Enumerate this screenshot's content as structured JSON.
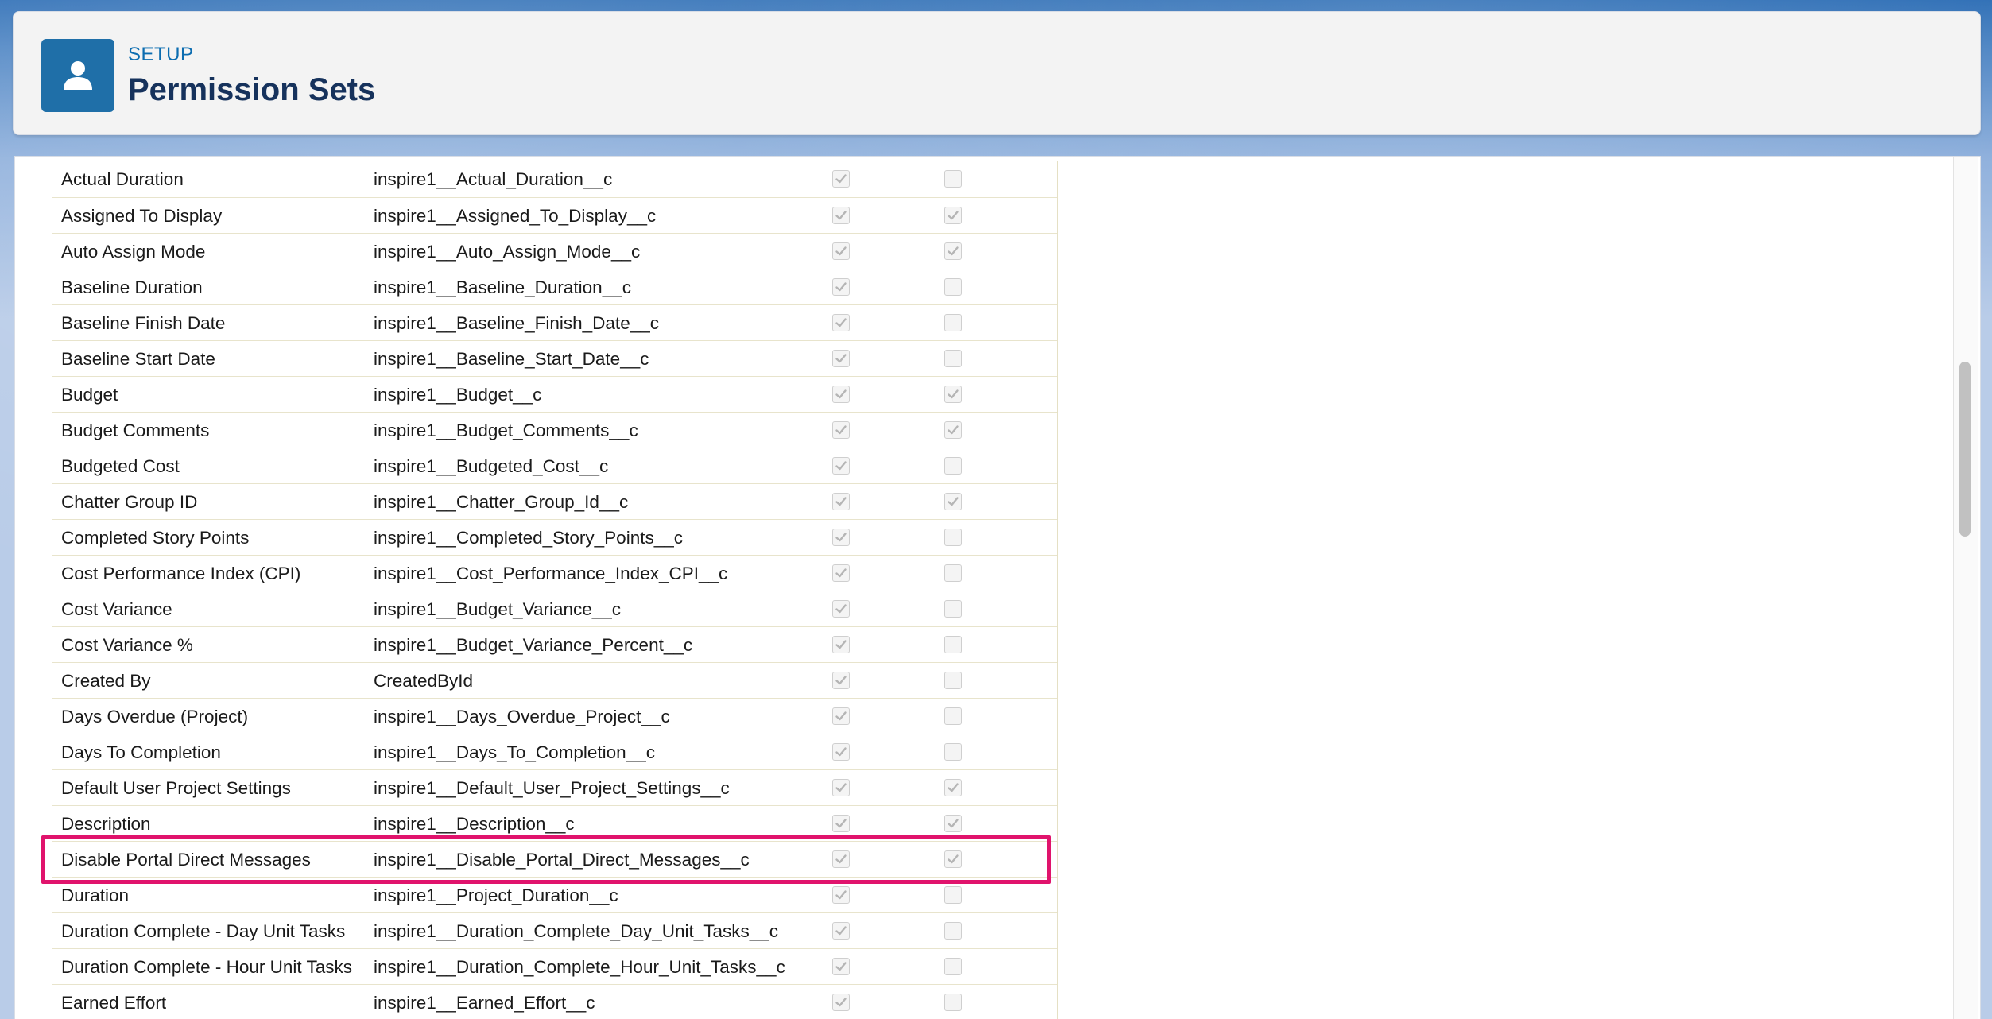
{
  "header": {
    "eyebrow": "SETUP",
    "title": "Permission Sets",
    "icon": "user-icon"
  },
  "colors": {
    "accent": "#1f6fa8",
    "highlight": "#e0136c",
    "title": "#16325c"
  },
  "fields": [
    {
      "label": "Actual Duration",
      "api": "inspire1__Actual_Duration__c",
      "read": true,
      "edit": false
    },
    {
      "label": "Assigned To Display",
      "api": "inspire1__Assigned_To_Display__c",
      "read": true,
      "edit": true
    },
    {
      "label": "Auto Assign Mode",
      "api": "inspire1__Auto_Assign_Mode__c",
      "read": true,
      "edit": true
    },
    {
      "label": "Baseline Duration",
      "api": "inspire1__Baseline_Duration__c",
      "read": true,
      "edit": false
    },
    {
      "label": "Baseline Finish Date",
      "api": "inspire1__Baseline_Finish_Date__c",
      "read": true,
      "edit": false
    },
    {
      "label": "Baseline Start Date",
      "api": "inspire1__Baseline_Start_Date__c",
      "read": true,
      "edit": false
    },
    {
      "label": "Budget",
      "api": "inspire1__Budget__c",
      "read": true,
      "edit": true
    },
    {
      "label": "Budget Comments",
      "api": "inspire1__Budget_Comments__c",
      "read": true,
      "edit": true
    },
    {
      "label": "Budgeted Cost",
      "api": "inspire1__Budgeted_Cost__c",
      "read": true,
      "edit": false
    },
    {
      "label": "Chatter Group ID",
      "api": "inspire1__Chatter_Group_Id__c",
      "read": true,
      "edit": true
    },
    {
      "label": "Completed Story Points",
      "api": "inspire1__Completed_Story_Points__c",
      "read": true,
      "edit": false
    },
    {
      "label": "Cost Performance Index (CPI)",
      "api": "inspire1__Cost_Performance_Index_CPI__c",
      "read": true,
      "edit": false
    },
    {
      "label": "Cost Variance",
      "api": "inspire1__Budget_Variance__c",
      "read": true,
      "edit": false
    },
    {
      "label": "Cost Variance %",
      "api": "inspire1__Budget_Variance_Percent__c",
      "read": true,
      "edit": false
    },
    {
      "label": "Created By",
      "api": "CreatedById",
      "read": true,
      "edit": false
    },
    {
      "label": "Days Overdue (Project)",
      "api": "inspire1__Days_Overdue_Project__c",
      "read": true,
      "edit": false
    },
    {
      "label": "Days To Completion",
      "api": "inspire1__Days_To_Completion__c",
      "read": true,
      "edit": false
    },
    {
      "label": "Default User Project Settings",
      "api": "inspire1__Default_User_Project_Settings__c",
      "read": true,
      "edit": true
    },
    {
      "label": "Description",
      "api": "inspire1__Description__c",
      "read": true,
      "edit": true
    },
    {
      "label": "Disable Portal Direct Messages",
      "api": "inspire1__Disable_Portal_Direct_Messages__c",
      "read": true,
      "edit": true,
      "highlighted": true
    },
    {
      "label": "Duration",
      "api": "inspire1__Project_Duration__c",
      "read": true,
      "edit": false
    },
    {
      "label": "Duration Complete - Day Unit Tasks",
      "api": "inspire1__Duration_Complete_Day_Unit_Tasks__c",
      "read": true,
      "edit": false
    },
    {
      "label": "Duration Complete - Hour Unit Tasks",
      "api": "inspire1__Duration_Complete_Hour_Unit_Tasks__c",
      "read": true,
      "edit": false
    },
    {
      "label": "Earned Effort",
      "api": "inspire1__Earned_Effort__c",
      "read": true,
      "edit": false
    }
  ]
}
